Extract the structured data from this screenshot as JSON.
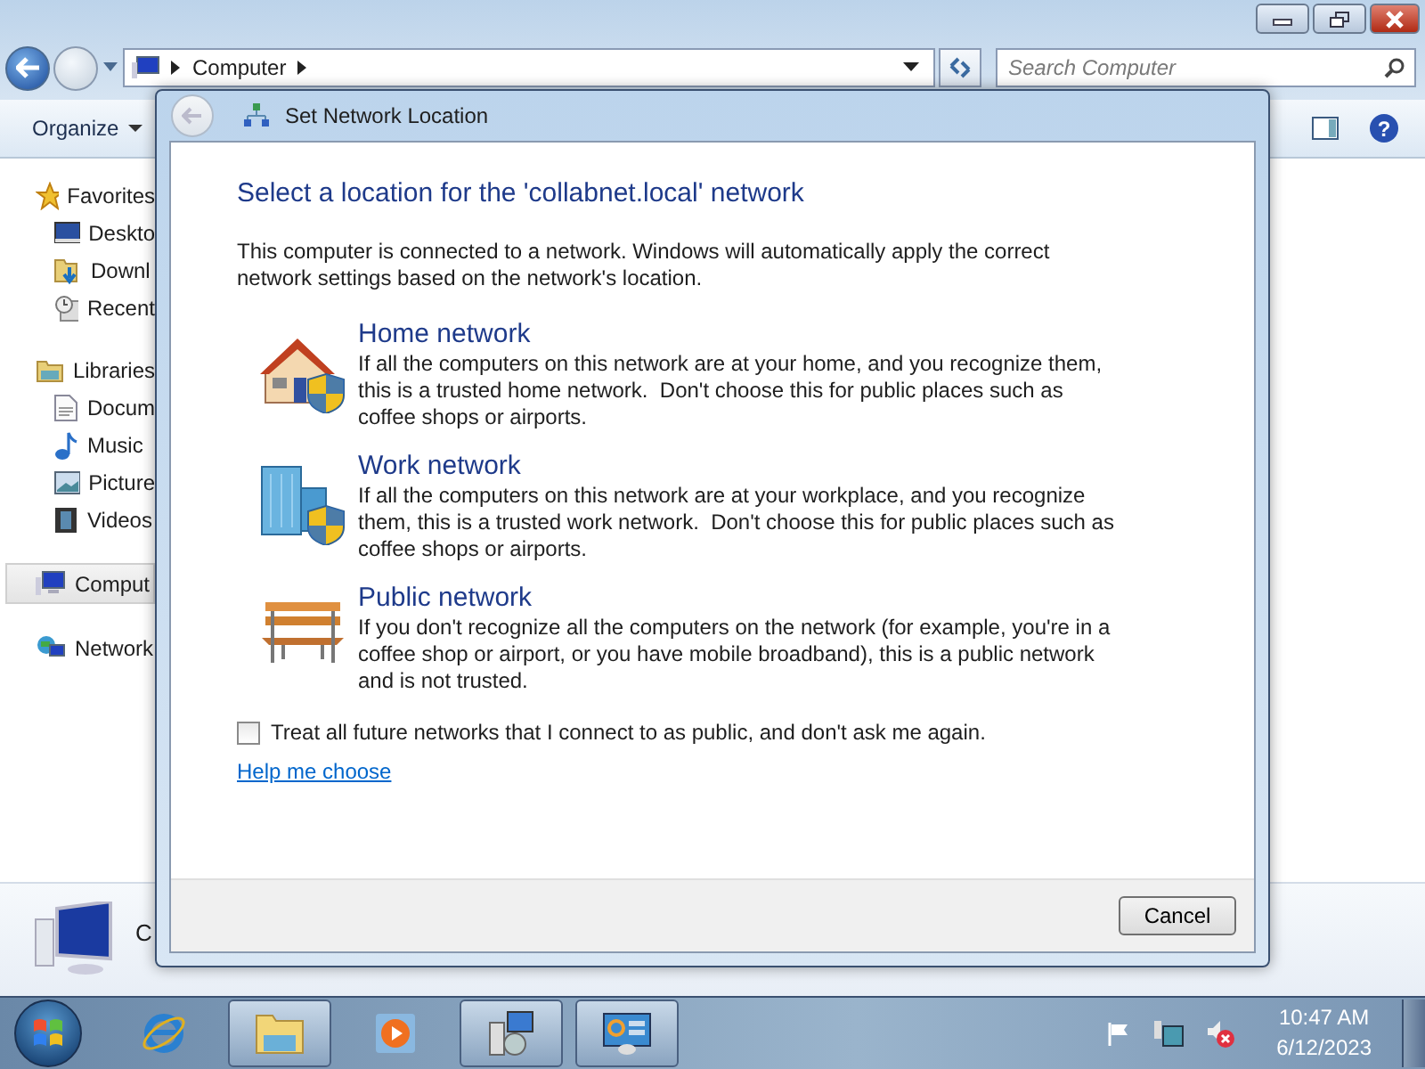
{
  "explorer": {
    "address_segments": [
      "Computer"
    ],
    "search_placeholder": "Search Computer",
    "toolbar": {
      "organize": "Organize",
      "help": "?"
    },
    "sidebar": [
      {
        "kind": "favorites",
        "label": "Favorites",
        "selected": false,
        "children": [
          {
            "kind": "desktop",
            "label": "Deskto",
            "selected": false
          },
          {
            "kind": "downloads",
            "label": "Downl",
            "selected": false
          },
          {
            "kind": "recent",
            "label": "Recent",
            "selected": false
          }
        ]
      },
      {
        "kind": "libraries",
        "label": "Libraries",
        "selected": false,
        "children": [
          {
            "kind": "documents",
            "label": "Docum",
            "selected": false
          },
          {
            "kind": "music",
            "label": "Music",
            "selected": false
          },
          {
            "kind": "pictures",
            "label": "Picture",
            "selected": false
          },
          {
            "kind": "videos",
            "label": "Videos",
            "selected": false
          }
        ]
      },
      {
        "kind": "computer",
        "label": "Comput",
        "selected": true
      },
      {
        "kind": "network",
        "label": "Network",
        "selected": false
      }
    ],
    "details": {
      "name": "C"
    }
  },
  "dialog": {
    "title": "Set Network Location",
    "heading": "Select a location for the 'collabnet.local' network",
    "intro": "This computer is connected to a network. Windows will automatically apply the correct network settings based on the network's location.",
    "options": [
      {
        "kind": "home",
        "title": "Home network",
        "description": "If all the computers on this network are at your home, and you recognize them, this is a trusted home network.  Don't choose this for public places such as coffee shops or airports."
      },
      {
        "kind": "work",
        "title": "Work network",
        "description": "If all the computers on this network are at your workplace, and you recognize them, this is a trusted work network.  Don't choose this for public places such as coffee shops or airports."
      },
      {
        "kind": "public",
        "title": "Public network",
        "description": "If you don't recognize all the computers on the network (for example, you're in a coffee shop or airport, or you have mobile broadband), this is a public network and is not trusted."
      }
    ],
    "checkbox": {
      "label": "Treat all future networks that I connect to as public, and don't ask me again.",
      "checked": false
    },
    "link": "Help me choose",
    "cancel": "Cancel"
  },
  "taskbar": {
    "items": [
      {
        "kind": "browser",
        "open": false
      },
      {
        "kind": "folder",
        "open": true
      },
      {
        "kind": "media",
        "open": false
      },
      {
        "kind": "installer",
        "open": true
      },
      {
        "kind": "control",
        "open": true
      }
    ],
    "time": "10:47 AM",
    "date": "6/12/2023"
  }
}
